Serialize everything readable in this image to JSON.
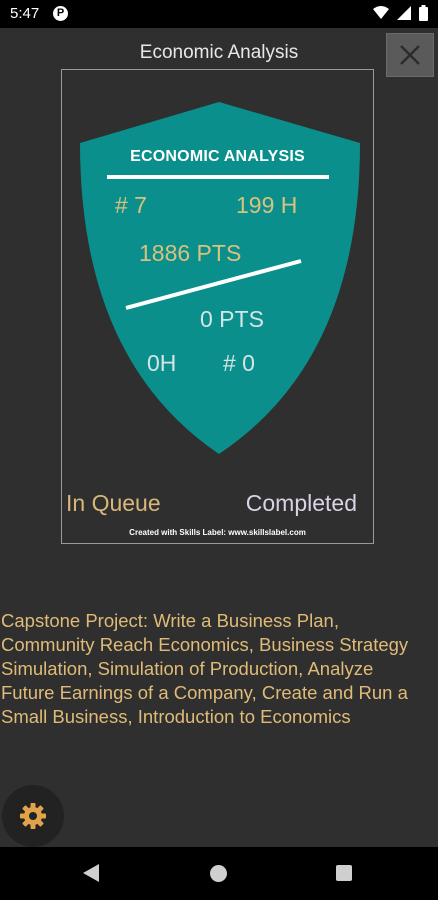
{
  "status_bar": {
    "time": "5:47",
    "app_icon": "P"
  },
  "header": {
    "title": "Economic Analysis"
  },
  "badge": {
    "title": "ECONOMIC ANALYSIS",
    "rank_top": "# 7",
    "hours_top": "199 H",
    "points_top": "1886 PTS",
    "points_bottom": "0 PTS",
    "hours_bottom": "0H",
    "rank_bottom": "# 0",
    "label_left": "In Queue",
    "label_right": "Completed",
    "credit": "Created with Skills Label: www.skillslabel.com",
    "shield_color": "#0b8f8c"
  },
  "courses": "Capstone Project: Write a Business Plan, Community Reach Economics, Business Strategy Simulation, Simulation of Production, Analyze Future Earnings of a Company, Create and Run a Small Business, Introduction to Economics",
  "colors": {
    "background": "#2f2f2f",
    "accent_gold": "#e0bb78",
    "shield": "#0b8f8c"
  },
  "icons": {
    "close": "close-icon",
    "settings": "gear-icon",
    "back": "back-triangle-icon",
    "home": "home-circle-icon",
    "recents": "recents-square-icon"
  }
}
